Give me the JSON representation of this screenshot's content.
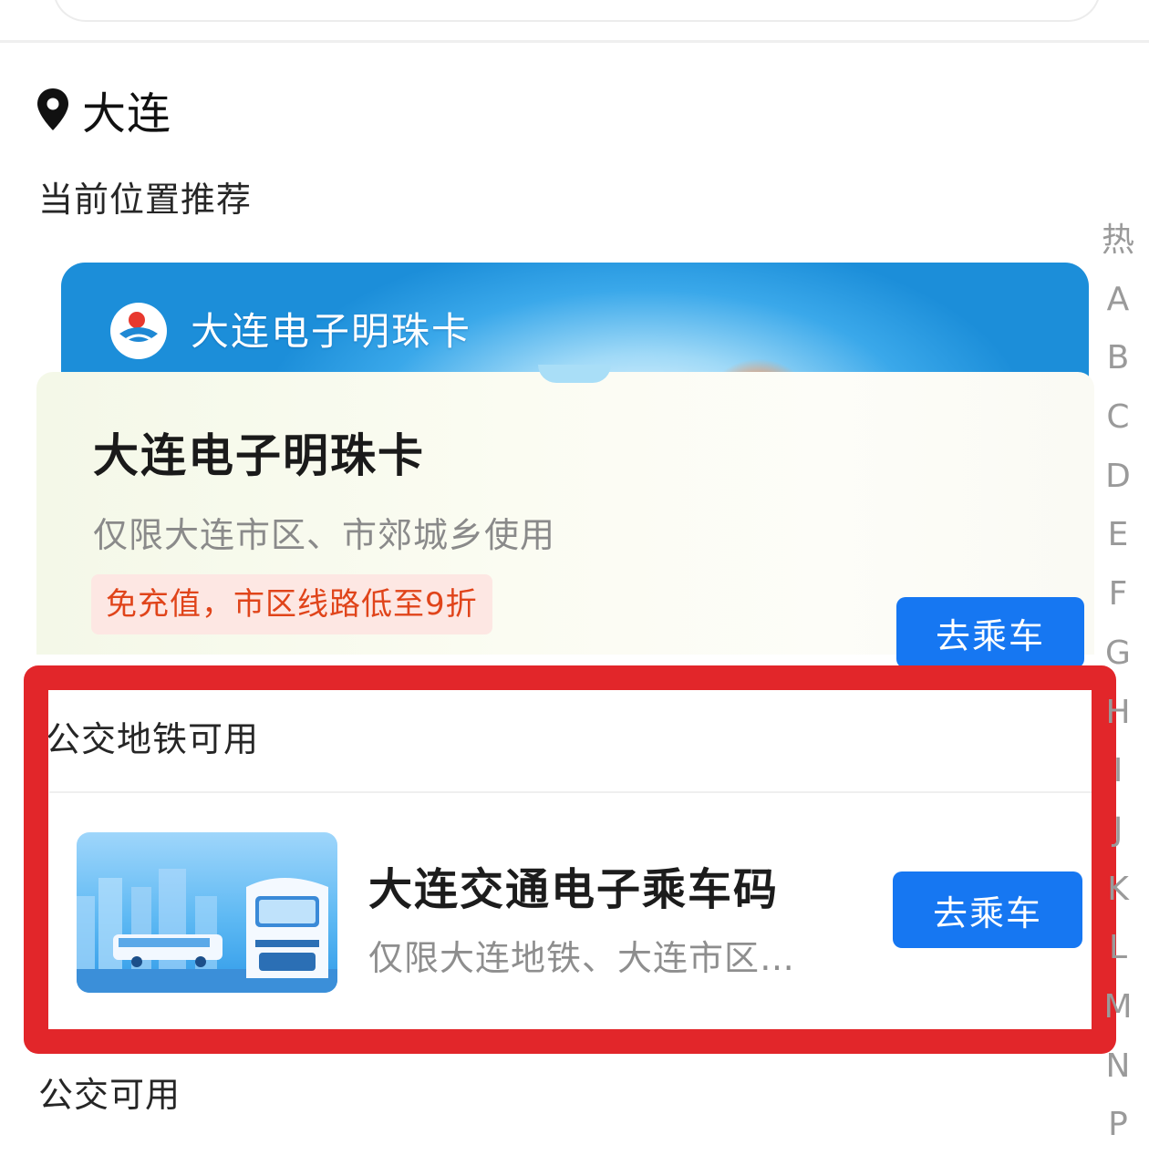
{
  "location": {
    "city": "大连",
    "icon": "location-pin-icon"
  },
  "sections": {
    "recommend_title": "当前位置推荐",
    "bus_metro_title": "公交地铁可用",
    "bus_title": "公交可用"
  },
  "pearl_card": {
    "banner_title": "大连电子明珠卡",
    "name": "大连电子明珠卡",
    "description": "仅限大连市区、市郊城乡使用",
    "promo": "免充值，市区线路低至9折",
    "button": "去乘车"
  },
  "metro_card": {
    "name": "大连交通电子乘车码",
    "description": "仅限大连地铁、大连市区…",
    "button": "去乘车"
  },
  "index_bar": [
    "热",
    "A",
    "B",
    "C",
    "D",
    "E",
    "F",
    "G",
    "H",
    "I",
    "J",
    "K",
    "L",
    "M",
    "N",
    "P"
  ],
  "colors": {
    "primary_button": "#1677f2",
    "highlight": "#e2262a",
    "promo_text": "#e0441a"
  }
}
